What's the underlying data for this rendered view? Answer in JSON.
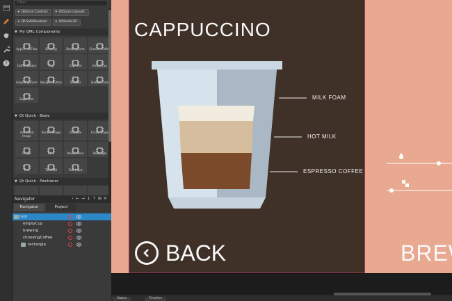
{
  "library": {
    "filter_placeholder": "Filter",
    "import_buttons": [
      "QtQuick.Controls",
      "QtQuick.Layouts",
      "Qt.SafeRenderer",
      "QtStudio3D"
    ],
    "sections": [
      {
        "title": "My QML Components",
        "items": [
          "Applic...onFlow",
          "Brewing",
          "BrewingForm",
          "Choosi...Coffee",
          "CofffeeButton",
          "Cup",
          "CupForm",
          "EmptyCup",
          "EmptyCupForm",
          "Naviga...Button",
          "SideBar",
          "SideBarForm",
          "SugarItem"
        ]
      },
      {
        "title": "Qt Quick - Basic",
        "items": [
          "Animated Image",
          "Border Image",
          "Flickable",
          "Focus Scope",
          "Image",
          "Item",
          "Mouse Area",
          "Rectangle",
          "Text",
          "Text Edit",
          "Text Input"
        ]
      },
      {
        "title": "Qt Quick - Positioner",
        "items": []
      }
    ]
  },
  "navigator": {
    "title": "Navigator",
    "tabs": [
      "Navigator",
      "Project"
    ],
    "tree": [
      {
        "name": "root",
        "selected": true
      },
      {
        "name": "emptyCup",
        "selected": false
      },
      {
        "name": "brewing",
        "selected": false
      },
      {
        "name": "choosingCoffee",
        "selected": false
      },
      {
        "name": "rectangle",
        "selected": false
      }
    ]
  },
  "app": {
    "title": "CAPPUCCINO",
    "ingredients": [
      "MILK FOAM",
      "HOT MILK",
      "ESPRESSO COFFEE"
    ],
    "back_label": "BACK",
    "brew_label": "BREW",
    "colors": {
      "background": "#e8a990",
      "panel": "#3f3028",
      "milk_foam": "#f2ebe0",
      "hot_milk": "#d6bd9e",
      "espresso": "#7a4a2a"
    }
  },
  "bottom_tabs": [
    "States",
    "Timeline"
  ],
  "icons": [
    "pencil-icon",
    "bug-icon",
    "wrench-icon",
    "help-icon",
    "chevron-left-icon",
    "water-drop-icon",
    "sugar-cube-icon"
  ]
}
